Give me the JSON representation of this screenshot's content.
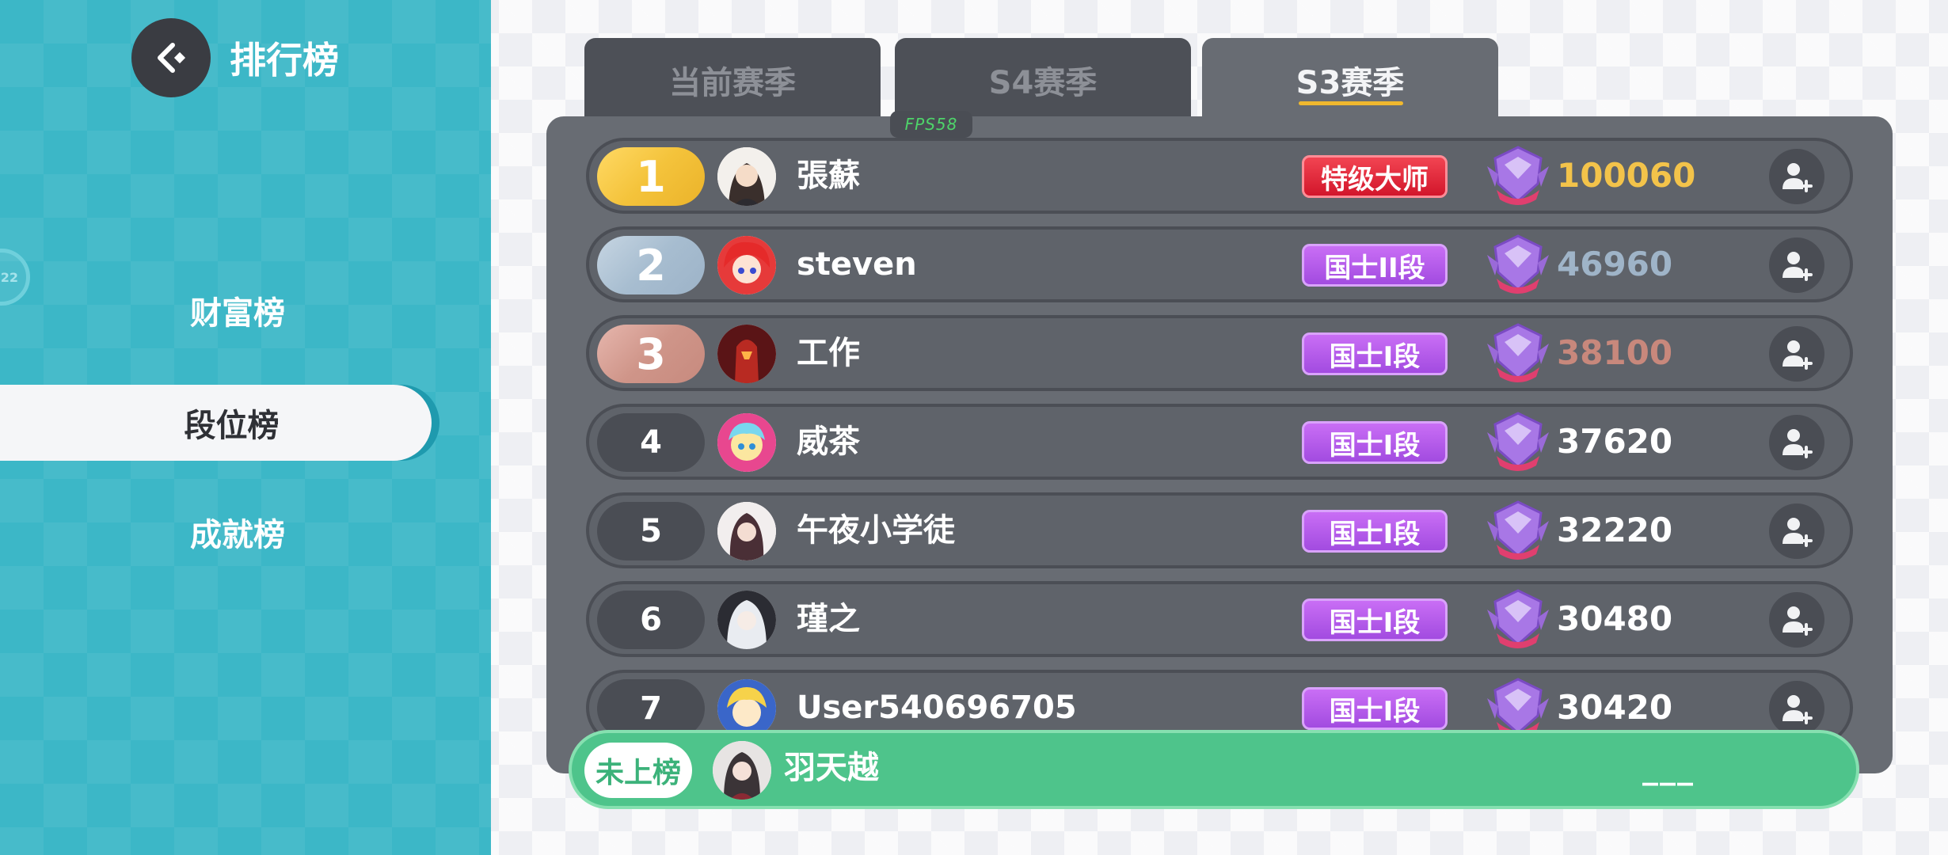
{
  "header": {
    "title": "排行榜"
  },
  "sidebar": {
    "ring_text": "22",
    "items": [
      {
        "label": "财富榜",
        "active": false
      },
      {
        "label": "段位榜",
        "active": true
      },
      {
        "label": "成就榜",
        "active": false
      }
    ]
  },
  "tabs": [
    {
      "label": "当前赛季",
      "active": false
    },
    {
      "label": "S4赛季",
      "active": false
    },
    {
      "label": "S3赛季",
      "active": true
    }
  ],
  "fps": "FPS58",
  "leaderboard": [
    {
      "rank": "1",
      "name": "張蘇",
      "tier": "特级大师",
      "score": "100060",
      "score_color": "#f3c34a"
    },
    {
      "rank": "2",
      "name": "steven",
      "tier": "国士II段",
      "score": "46960",
      "score_color": "#9fb4c8"
    },
    {
      "rank": "3",
      "name": "工作",
      "tier": "国士I段",
      "score": "38100",
      "score_color": "#c8887c"
    },
    {
      "rank": "4",
      "name": "威茶",
      "tier": "国士I段",
      "score": "37620",
      "score_color": "#ffffff"
    },
    {
      "rank": "5",
      "name": "午夜小学徒",
      "tier": "国士I段",
      "score": "32220",
      "score_color": "#ffffff"
    },
    {
      "rank": "6",
      "name": "瑾之",
      "tier": "国士I段",
      "score": "30480",
      "score_color": "#ffffff"
    },
    {
      "rank": "7",
      "name": "User540696705",
      "tier": "国士I段",
      "score": "30420",
      "score_color": "#ffffff"
    }
  ],
  "self": {
    "tag": "未上榜",
    "name": "羽天越",
    "score": "___"
  },
  "colors": {
    "sidebar": "#3cb7c7",
    "panel": "#686c73",
    "self_bar": "#4ec48b",
    "tab_underline": "#f0b82e"
  }
}
